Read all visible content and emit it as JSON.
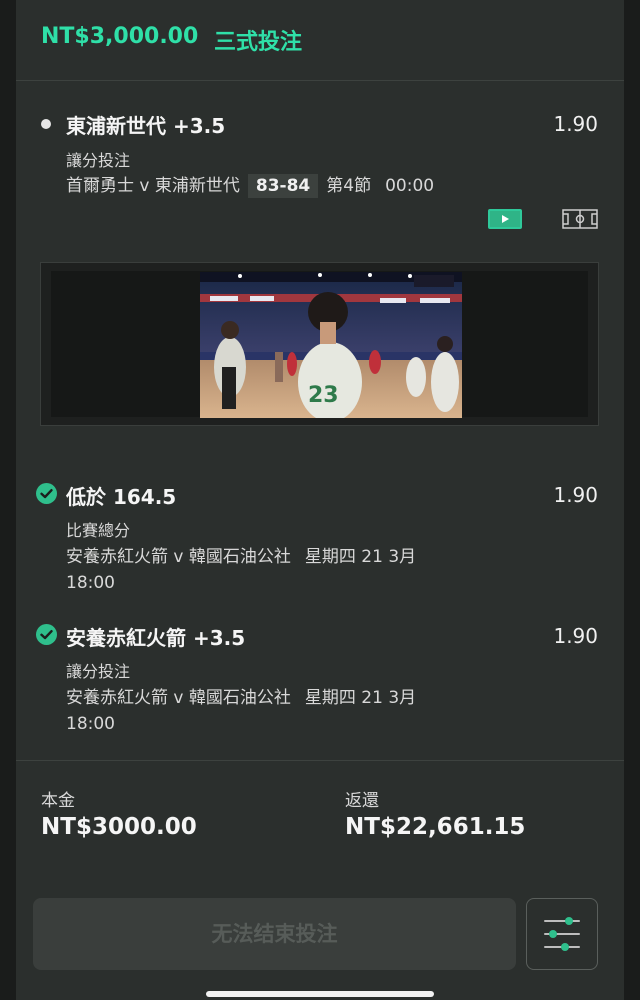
{
  "header": {
    "amount": "NT$3,000.00",
    "bet_type": "三式投注"
  },
  "selections": [
    {
      "status": "open",
      "title": "東浦新世代 +3.5",
      "odds": "1.90",
      "market": "讓分投注",
      "match": "首爾勇士 v 東浦新世代",
      "score": "83-84",
      "period": "第4節",
      "clock": "00:00",
      "icons": [
        "live-stream-icon",
        "court-icon"
      ]
    },
    {
      "status": "won",
      "title": "低於 164.5",
      "odds": "1.90",
      "market": "比賽總分",
      "match": "安養赤紅火箭 v 韓國石油公社",
      "date": "星期四 21 3月",
      "time": "18:00"
    },
    {
      "status": "won",
      "title": "安養赤紅火箭 +3.5",
      "odds": "1.90",
      "market": "讓分投注",
      "match": "安養赤紅火箭 v 韓國石油公社",
      "date": "星期四 21 3月",
      "time": "18:00"
    }
  ],
  "summary": {
    "stake_label": "本金",
    "stake_value": "NT$3000.00",
    "return_label": "返還",
    "return_value": "NT$22,661.15"
  },
  "actions": {
    "cashout_label": "无法结束投注",
    "settings_icon": "sliders-icon"
  },
  "colors": {
    "accent": "#2fe0a8",
    "panel": "#2b2f2d",
    "check": "#2fbf8c"
  }
}
